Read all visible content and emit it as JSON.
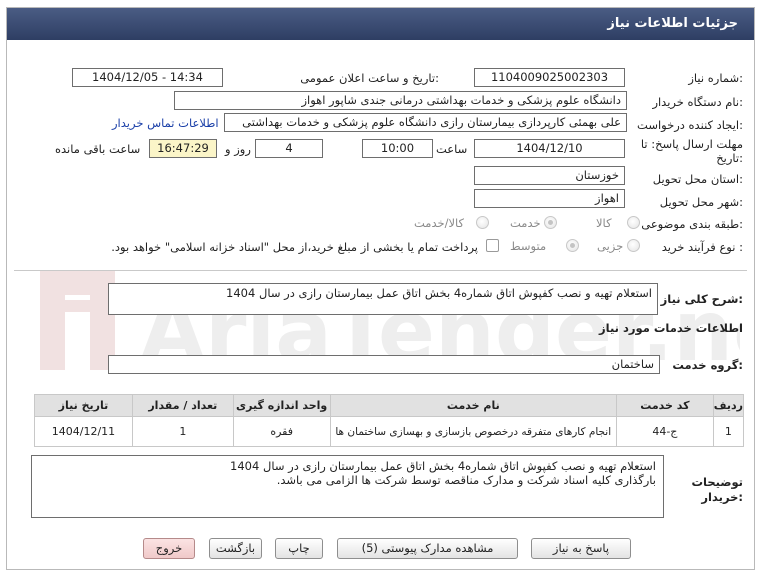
{
  "header": {
    "title": "جزئیات اطلاعات نیاز"
  },
  "form": {
    "need_number": {
      "label": "شماره نیاز:",
      "value": "1104009025002303"
    },
    "announce_datetime": {
      "label": "تاریخ و ساعت اعلان عمومی:",
      "value": "1404/12/05 - 14:34"
    },
    "buyer_org": {
      "label": "نام دستگاه خریدار:",
      "value": "دانشگاه علوم پزشکی و خدمات بهداشتی درمانی جندی شاپور اهواز"
    },
    "requester": {
      "label": "ایجاد کننده درخواست:",
      "value": "علی بهمئی کارپردازی بیمارستان رازی دانشگاه علوم پزشکی و خدمات بهداشتی",
      "contact_link": "اطلاعات تماس خریدار"
    },
    "deadline": {
      "label_line1": "مهلت ارسال پاسخ: تا",
      "label_line2": "تاریخ:",
      "date": "1404/12/10",
      "time_label": "ساعت",
      "time": "10:00",
      "days": "4",
      "days_label": "روز و",
      "remaining": "16:47:29",
      "remaining_label": "ساعت باقی مانده"
    },
    "province": {
      "label": "استان محل تحویل:",
      "value": "خوزستان"
    },
    "city": {
      "label": "شهر محل تحویل:",
      "value": "اهواز"
    },
    "category": {
      "label": "طبقه بندی موضوعی:",
      "options": [
        "کالا",
        "خدمت",
        "کالا/خدمت"
      ],
      "selected": "خدمت"
    },
    "purchase_type": {
      "label": "نوع فرآیند خرید :",
      "options": [
        "جزیی",
        "متوسط"
      ],
      "selected": "متوسط",
      "note": "پرداخت تمام یا بخشی از مبلغ خرید،از محل \"اسناد خزانه اسلامی\" خواهد بود."
    }
  },
  "summary": {
    "label": "شرح کلی نیاز:",
    "value": "استعلام تهیه و نصب کفپوش اتاق شماره4 بخش اتاق عمل بیمارستان رازی در سال 1404"
  },
  "services": {
    "section_title": "اطلاعات خدمات مورد نیاز",
    "group_label": "گروه خدمت:",
    "group_value": "ساختمان",
    "columns": [
      "ردیف",
      "کد خدمت",
      "نام خدمت",
      "واحد اندازه گیری",
      "تعداد / مقدار",
      "تاریخ نیاز"
    ],
    "rows": [
      {
        "row": "1",
        "code": "ج-44",
        "name": "انجام کارهای متفرقه درخصوص بازسازی و بهسازی ساختمان ها",
        "unit": "فقره",
        "qty": "1",
        "date": "1404/12/11"
      }
    ]
  },
  "buyer_notes": {
    "label_line1": "توضیحات",
    "label_line2": "خریدار:",
    "line1": "استعلام تهیه و نصب کفپوش اتاق شماره4 بخش اتاق عمل بیمارستان رازی در سال 1404",
    "line2": "بارگذاری کلیه اسناد شرکت و مدارک مناقصه توسط شرکت ها الزامی می باشد."
  },
  "buttons": {
    "reply": "پاسخ به نیاز",
    "docs": "مشاهده مدارک پیوستی (5)",
    "print": "چاپ",
    "back": "بازگشت",
    "exit": "خروج"
  },
  "watermark": {
    "text": "AriaTender.net"
  },
  "colors": {
    "header_bg": "#3b4c74",
    "link": "#1a3fa8",
    "yellow_box": "#fbf5c8",
    "exit_btn": "#f0c9c9"
  }
}
